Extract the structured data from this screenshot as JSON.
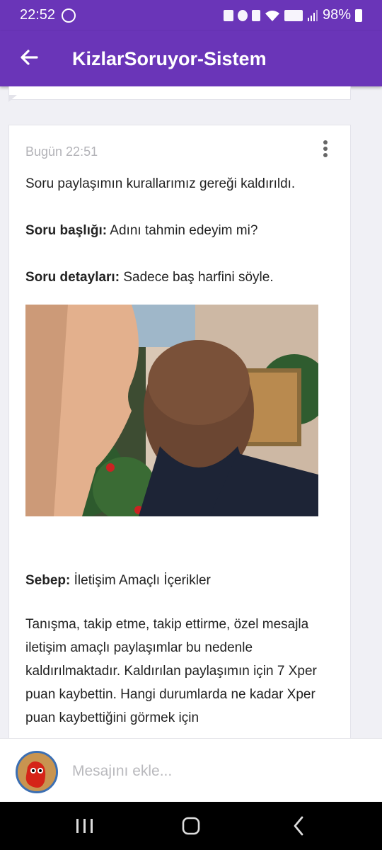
{
  "status_bar": {
    "time": "22:52",
    "battery": "98%"
  },
  "app_bar": {
    "title": "KizlarSoruyor-Sistem"
  },
  "message": {
    "time": "Bugün 22:51",
    "intro": "Soru paylaşımın kurallarımız gereği kaldırıldı.",
    "title_label": "Soru başlığı:",
    "title_value": " Adını tahmin edeyim mi?",
    "details_label": "Soru detayları:",
    "details_value": " Sadece baş harfini söyle.",
    "reason_label": "Sebep:",
    "reason_value": " İletişim Amaçlı İçerikler",
    "explanation": "Tanışma, takip etme, takip ettirme, özel mesajla iletişim amaçlı paylaşımlar bu nedenle kaldırılmaktadır. Kaldırılan paylaşımın için 7 Xper puan kaybettin. Hangi durumlarda ne kadar Xper puan kaybettiğini görmek için"
  },
  "composer": {
    "placeholder": "Mesajını ekle..."
  },
  "colors": {
    "app_bar": "#6a35b8",
    "background": "#f0f0f5"
  }
}
